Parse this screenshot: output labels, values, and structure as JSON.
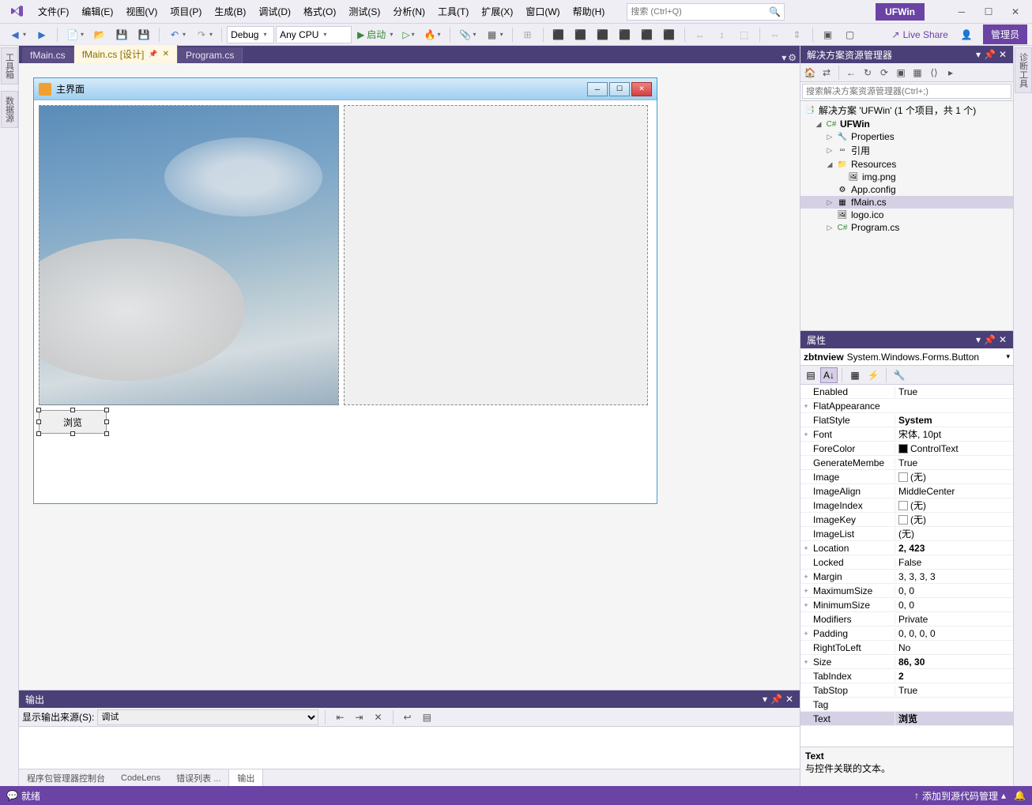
{
  "title_tag": "UFWin",
  "menu": {
    "file": "文件(F)",
    "edit": "编辑(E)",
    "view": "视图(V)",
    "project": "项目(P)",
    "build": "生成(B)",
    "debug": "调试(D)",
    "format": "格式(O)",
    "test": "测试(S)",
    "analyze": "分析(N)",
    "tools": "工具(T)",
    "extensions": "扩展(X)",
    "window": "窗口(W)",
    "help": "帮助(H)"
  },
  "search_placeholder": "搜索 (Ctrl+Q)",
  "toolbar": {
    "config": "Debug",
    "platform": "Any CPU",
    "start": "启动",
    "live_share": "Live Share",
    "admin": "管理员"
  },
  "left_rail": {
    "toolbox": "工具箱",
    "datasource": "数据源"
  },
  "right_rail": {
    "diag": "诊断工具"
  },
  "tabs": [
    {
      "label": "fMain.cs",
      "active": false
    },
    {
      "label": "fMain.cs [设计]",
      "active": true
    },
    {
      "label": "Program.cs",
      "active": false
    }
  ],
  "designer_form": {
    "title": "主界面",
    "button_text": "浏览"
  },
  "output": {
    "title": "输出",
    "source_label": "显示输出来源(S):",
    "source_value": "调试"
  },
  "bottom_tabs": [
    "程序包管理器控制台",
    "CodeLens",
    "错误列表 ...",
    "输出"
  ],
  "solution": {
    "title": "解决方案资源管理器",
    "search_placeholder": "搜索解决方案资源管理器(Ctrl+;)",
    "root": "解决方案 'UFWin' (1 个项目，共 1 个)",
    "project": "UFWin",
    "items": {
      "properties": "Properties",
      "references": "引用",
      "resources": "Resources",
      "img": "img.png",
      "appconfig": "App.config",
      "fmain": "fMain.cs",
      "logo": "logo.ico",
      "program": "Program.cs"
    }
  },
  "properties": {
    "title": "属性",
    "object_name": "zbtnview",
    "object_type": "System.Windows.Forms.Button",
    "rows": [
      {
        "exp": "",
        "name": "Enabled",
        "val": "True",
        "bold": false
      },
      {
        "exp": "+",
        "name": "FlatAppearance",
        "val": "",
        "bold": false
      },
      {
        "exp": "",
        "name": "FlatStyle",
        "val": "System",
        "bold": true
      },
      {
        "exp": "+",
        "name": "Font",
        "val": "宋体, 10pt",
        "bold": false
      },
      {
        "exp": "",
        "name": "ForeColor",
        "val": "ControlText",
        "bold": false,
        "swatch": "black"
      },
      {
        "exp": "",
        "name": "GenerateMembe",
        "val": "True",
        "bold": false
      },
      {
        "exp": "",
        "name": "Image",
        "val": "(无)",
        "bold": false,
        "swatch": "white"
      },
      {
        "exp": "",
        "name": "ImageAlign",
        "val": "MiddleCenter",
        "bold": false
      },
      {
        "exp": "",
        "name": "ImageIndex",
        "val": "(无)",
        "bold": false,
        "swatch": "white"
      },
      {
        "exp": "",
        "name": "ImageKey",
        "val": "(无)",
        "bold": false,
        "swatch": "white"
      },
      {
        "exp": "",
        "name": "ImageList",
        "val": "(无)",
        "bold": false
      },
      {
        "exp": "+",
        "name": "Location",
        "val": "2, 423",
        "bold": true
      },
      {
        "exp": "",
        "name": "Locked",
        "val": "False",
        "bold": false
      },
      {
        "exp": "+",
        "name": "Margin",
        "val": "3, 3, 3, 3",
        "bold": false
      },
      {
        "exp": "+",
        "name": "MaximumSize",
        "val": "0, 0",
        "bold": false
      },
      {
        "exp": "+",
        "name": "MinimumSize",
        "val": "0, 0",
        "bold": false
      },
      {
        "exp": "",
        "name": "Modifiers",
        "val": "Private",
        "bold": false
      },
      {
        "exp": "+",
        "name": "Padding",
        "val": "0, 0, 0, 0",
        "bold": false
      },
      {
        "exp": "",
        "name": "RightToLeft",
        "val": "No",
        "bold": false
      },
      {
        "exp": "+",
        "name": "Size",
        "val": "86, 30",
        "bold": true
      },
      {
        "exp": "",
        "name": "TabIndex",
        "val": "2",
        "bold": true
      },
      {
        "exp": "",
        "name": "TabStop",
        "val": "True",
        "bold": false
      },
      {
        "exp": "",
        "name": "Tag",
        "val": "",
        "bold": false
      },
      {
        "exp": "",
        "name": "Text",
        "val": "浏览",
        "bold": true,
        "sel": true
      }
    ],
    "desc_title": "Text",
    "desc_text": "与控件关联的文本。"
  },
  "status": {
    "ready": "就绪",
    "source_control": "添加到源代码管理"
  }
}
